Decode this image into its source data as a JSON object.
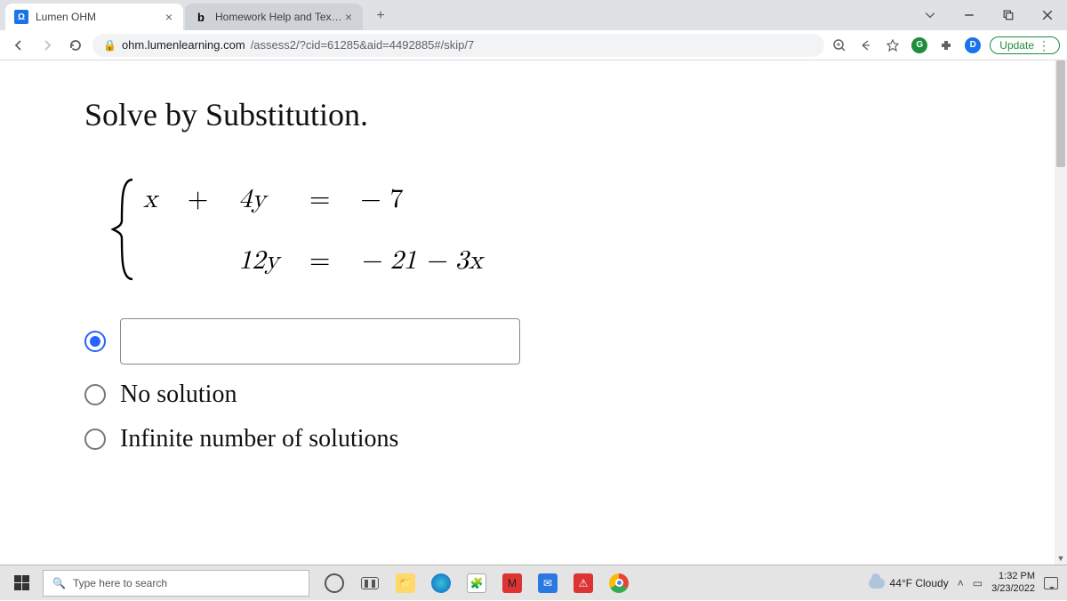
{
  "browser": {
    "tabs": [
      {
        "title": "Lumen OHM",
        "favicon_letter": "Ω"
      },
      {
        "title": "Homework Help and Textbook So",
        "favicon_letter": "b"
      }
    ],
    "url_domain": "ohm.lumenlearning.com",
    "url_path": "/assess2/?cid=61285&aid=4492885#/skip/7",
    "update_label": "Update",
    "profile_letter": "D"
  },
  "question": {
    "title": "Solve by Substitution.",
    "eq1": {
      "lhs_a": "x",
      "op": "+",
      "lhs_b": "4y",
      "eq": "=",
      "rhs": "− 7"
    },
    "eq2": {
      "lhs_a": "",
      "op": "",
      "lhs_b": "12y",
      "eq": "=",
      "rhs": "− 21 − 3x"
    },
    "options": {
      "no_solution": "No solution",
      "infinite": "Infinite number of solutions"
    }
  },
  "taskbar": {
    "search_placeholder": "Type here to search",
    "weather": "44°F Cloudy",
    "time": "1:32 PM",
    "date": "3/23/2022"
  }
}
